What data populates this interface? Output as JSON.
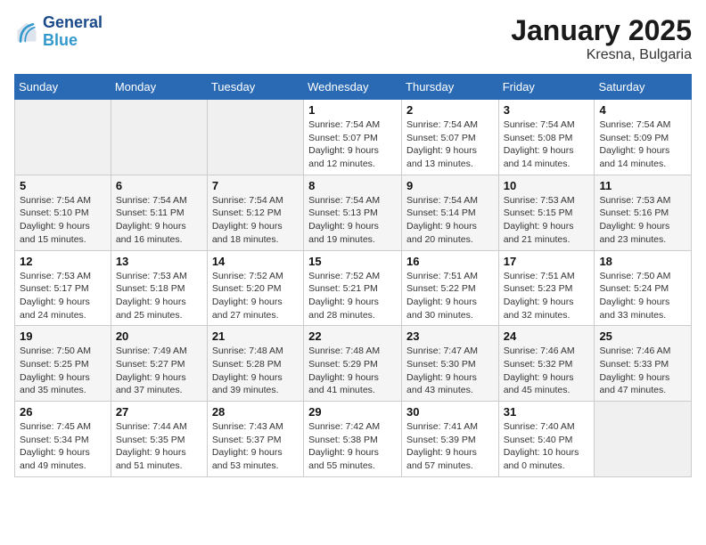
{
  "logo": {
    "line1": "General",
    "line2": "Blue"
  },
  "title": "January 2025",
  "location": "Kresna, Bulgaria",
  "weekdays": [
    "Sunday",
    "Monday",
    "Tuesday",
    "Wednesday",
    "Thursday",
    "Friday",
    "Saturday"
  ],
  "weeks": [
    [
      {
        "day": "",
        "info": ""
      },
      {
        "day": "",
        "info": ""
      },
      {
        "day": "",
        "info": ""
      },
      {
        "day": "1",
        "info": "Sunrise: 7:54 AM\nSunset: 5:07 PM\nDaylight: 9 hours\nand 12 minutes."
      },
      {
        "day": "2",
        "info": "Sunrise: 7:54 AM\nSunset: 5:07 PM\nDaylight: 9 hours\nand 13 minutes."
      },
      {
        "day": "3",
        "info": "Sunrise: 7:54 AM\nSunset: 5:08 PM\nDaylight: 9 hours\nand 14 minutes."
      },
      {
        "day": "4",
        "info": "Sunrise: 7:54 AM\nSunset: 5:09 PM\nDaylight: 9 hours\nand 14 minutes."
      }
    ],
    [
      {
        "day": "5",
        "info": "Sunrise: 7:54 AM\nSunset: 5:10 PM\nDaylight: 9 hours\nand 15 minutes."
      },
      {
        "day": "6",
        "info": "Sunrise: 7:54 AM\nSunset: 5:11 PM\nDaylight: 9 hours\nand 16 minutes."
      },
      {
        "day": "7",
        "info": "Sunrise: 7:54 AM\nSunset: 5:12 PM\nDaylight: 9 hours\nand 18 minutes."
      },
      {
        "day": "8",
        "info": "Sunrise: 7:54 AM\nSunset: 5:13 PM\nDaylight: 9 hours\nand 19 minutes."
      },
      {
        "day": "9",
        "info": "Sunrise: 7:54 AM\nSunset: 5:14 PM\nDaylight: 9 hours\nand 20 minutes."
      },
      {
        "day": "10",
        "info": "Sunrise: 7:53 AM\nSunset: 5:15 PM\nDaylight: 9 hours\nand 21 minutes."
      },
      {
        "day": "11",
        "info": "Sunrise: 7:53 AM\nSunset: 5:16 PM\nDaylight: 9 hours\nand 23 minutes."
      }
    ],
    [
      {
        "day": "12",
        "info": "Sunrise: 7:53 AM\nSunset: 5:17 PM\nDaylight: 9 hours\nand 24 minutes."
      },
      {
        "day": "13",
        "info": "Sunrise: 7:53 AM\nSunset: 5:18 PM\nDaylight: 9 hours\nand 25 minutes."
      },
      {
        "day": "14",
        "info": "Sunrise: 7:52 AM\nSunset: 5:20 PM\nDaylight: 9 hours\nand 27 minutes."
      },
      {
        "day": "15",
        "info": "Sunrise: 7:52 AM\nSunset: 5:21 PM\nDaylight: 9 hours\nand 28 minutes."
      },
      {
        "day": "16",
        "info": "Sunrise: 7:51 AM\nSunset: 5:22 PM\nDaylight: 9 hours\nand 30 minutes."
      },
      {
        "day": "17",
        "info": "Sunrise: 7:51 AM\nSunset: 5:23 PM\nDaylight: 9 hours\nand 32 minutes."
      },
      {
        "day": "18",
        "info": "Sunrise: 7:50 AM\nSunset: 5:24 PM\nDaylight: 9 hours\nand 33 minutes."
      }
    ],
    [
      {
        "day": "19",
        "info": "Sunrise: 7:50 AM\nSunset: 5:25 PM\nDaylight: 9 hours\nand 35 minutes."
      },
      {
        "day": "20",
        "info": "Sunrise: 7:49 AM\nSunset: 5:27 PM\nDaylight: 9 hours\nand 37 minutes."
      },
      {
        "day": "21",
        "info": "Sunrise: 7:48 AM\nSunset: 5:28 PM\nDaylight: 9 hours\nand 39 minutes."
      },
      {
        "day": "22",
        "info": "Sunrise: 7:48 AM\nSunset: 5:29 PM\nDaylight: 9 hours\nand 41 minutes."
      },
      {
        "day": "23",
        "info": "Sunrise: 7:47 AM\nSunset: 5:30 PM\nDaylight: 9 hours\nand 43 minutes."
      },
      {
        "day": "24",
        "info": "Sunrise: 7:46 AM\nSunset: 5:32 PM\nDaylight: 9 hours\nand 45 minutes."
      },
      {
        "day": "25",
        "info": "Sunrise: 7:46 AM\nSunset: 5:33 PM\nDaylight: 9 hours\nand 47 minutes."
      }
    ],
    [
      {
        "day": "26",
        "info": "Sunrise: 7:45 AM\nSunset: 5:34 PM\nDaylight: 9 hours\nand 49 minutes."
      },
      {
        "day": "27",
        "info": "Sunrise: 7:44 AM\nSunset: 5:35 PM\nDaylight: 9 hours\nand 51 minutes."
      },
      {
        "day": "28",
        "info": "Sunrise: 7:43 AM\nSunset: 5:37 PM\nDaylight: 9 hours\nand 53 minutes."
      },
      {
        "day": "29",
        "info": "Sunrise: 7:42 AM\nSunset: 5:38 PM\nDaylight: 9 hours\nand 55 minutes."
      },
      {
        "day": "30",
        "info": "Sunrise: 7:41 AM\nSunset: 5:39 PM\nDaylight: 9 hours\nand 57 minutes."
      },
      {
        "day": "31",
        "info": "Sunrise: 7:40 AM\nSunset: 5:40 PM\nDaylight: 10 hours\nand 0 minutes."
      },
      {
        "day": "",
        "info": ""
      }
    ]
  ]
}
